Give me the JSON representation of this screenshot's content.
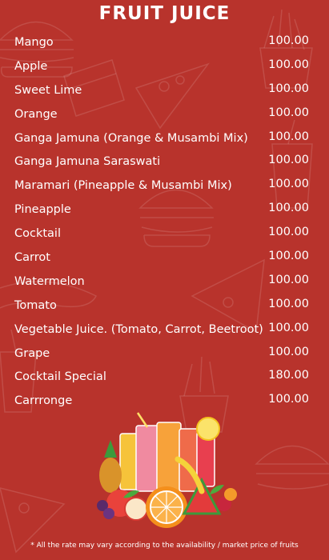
{
  "title": "FRUIT JUICE",
  "items": [
    {
      "name": "Mango",
      "price": "100.00"
    },
    {
      "name": "Apple",
      "price": "100.00"
    },
    {
      "name": "Sweet Lime",
      "price": "100.00"
    },
    {
      "name": "Orange",
      "price": "100.00"
    },
    {
      "name": "Ganga Jamuna (Orange & Musambi Mix)",
      "price": "100.00"
    },
    {
      "name": "Ganga Jamuna Saraswati",
      "price": "100.00"
    },
    {
      "name": "Maramari (Pineapple & Musambi Mix)",
      "price": "100.00"
    },
    {
      "name": "Pineapple",
      "price": "100.00"
    },
    {
      "name": "Cocktail",
      "price": "100.00"
    },
    {
      "name": "Carrot",
      "price": "100.00"
    },
    {
      "name": "Watermelon",
      "price": "100.00"
    },
    {
      "name": "Tomato",
      "price": "100.00"
    },
    {
      "name": "Vegetable Juice. (Tomato, Carrot, Beetroot)",
      "price": "100.00"
    },
    {
      "name": "Grape",
      "price": "100.00"
    },
    {
      "name": "Cocktail Special",
      "price": "180.00"
    },
    {
      "name": "Carrronge",
      "price": "100.00"
    }
  ],
  "footnote": "* All the rate may vary according to the availability / market price of fruits",
  "colors": {
    "background": "#b8332c",
    "text": "#ffffff"
  }
}
